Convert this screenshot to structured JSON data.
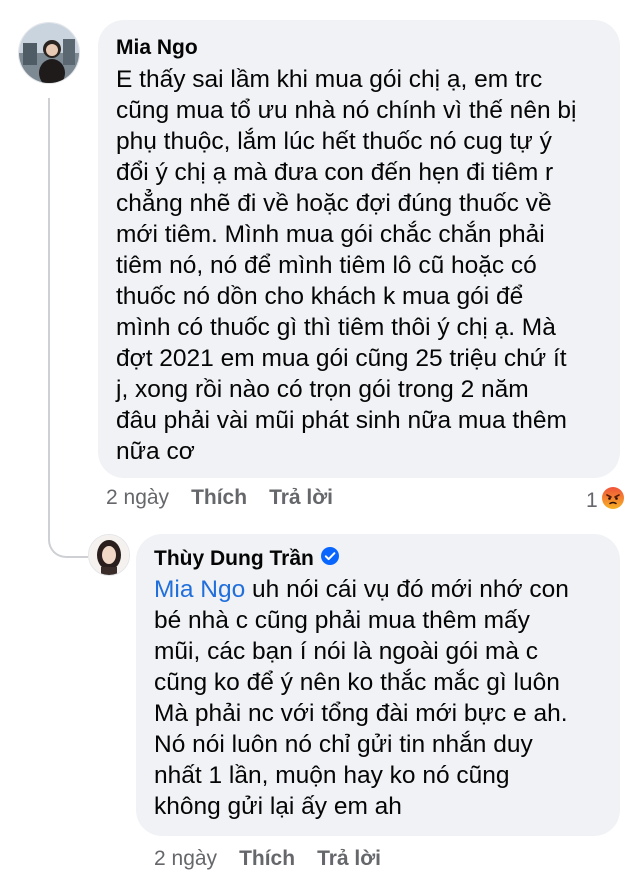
{
  "comment": {
    "author": "Mia Ngo",
    "text": "E thấy sai lầm khi mua gói chị ạ, em trc\ncũng mua tổ ưu nhà nó chính vì thế nên bị\nphụ thuộc, lắm lúc hết thuốc nó cug tự ý\nđổi ý chị ạ mà đưa con đến hẹn đi tiêm r\nchẳng nhẽ đi về hoặc đợi đúng thuốc về\nmới tiêm.  Mình mua gói chắc chắn phải\ntiêm nó, nó để mình tiêm lô cũ hoặc có\nthuốc nó dồn cho khách k mua gói để\nmình có thuốc gì thì tiêm thôi ý chị ạ. Mà\nđợt 2021 em mua gói cũng 25 triệu chứ ít\nj, xong rồi nào có trọn gói trong 2 năm\nđâu phải vài mũi phát sinh nữa mua thêm\nnữa cơ",
    "time": "2 ngày",
    "like_label": "Thích",
    "reply_label": "Trả lời",
    "reaction_count": "1",
    "reaction_icon": "angry-emoji-icon",
    "reaction_color": "#e9710f"
  },
  "reply": {
    "author": "Thùy Dung Trần",
    "verified": true,
    "verified_color": "#0866ff",
    "mention": "Mia Ngo",
    "text_first_line": " uh nói cái vụ đó mới nhớ con",
    "text": "bé nhà c cũng phải mua thêm mấy\nmũi, các bạn í nói là ngoài gói mà c\ncũng ko để ý nên ko thắc mắc gì luôn\nMà phải nc với tổng đài mới bực e ah.\nNó nói luôn nó chỉ gửi tin nhắn duy\nnhất 1 lần, muộn hay ko nó cũng\nkhông gửi lại ấy em ah",
    "time": "2 ngày",
    "like_label": "Thích",
    "reply_label": "Trả lời"
  },
  "colors": {
    "bubble": "#f0f2f5",
    "text": "#050505",
    "meta": "#65676b",
    "mention": "#216fdb"
  }
}
